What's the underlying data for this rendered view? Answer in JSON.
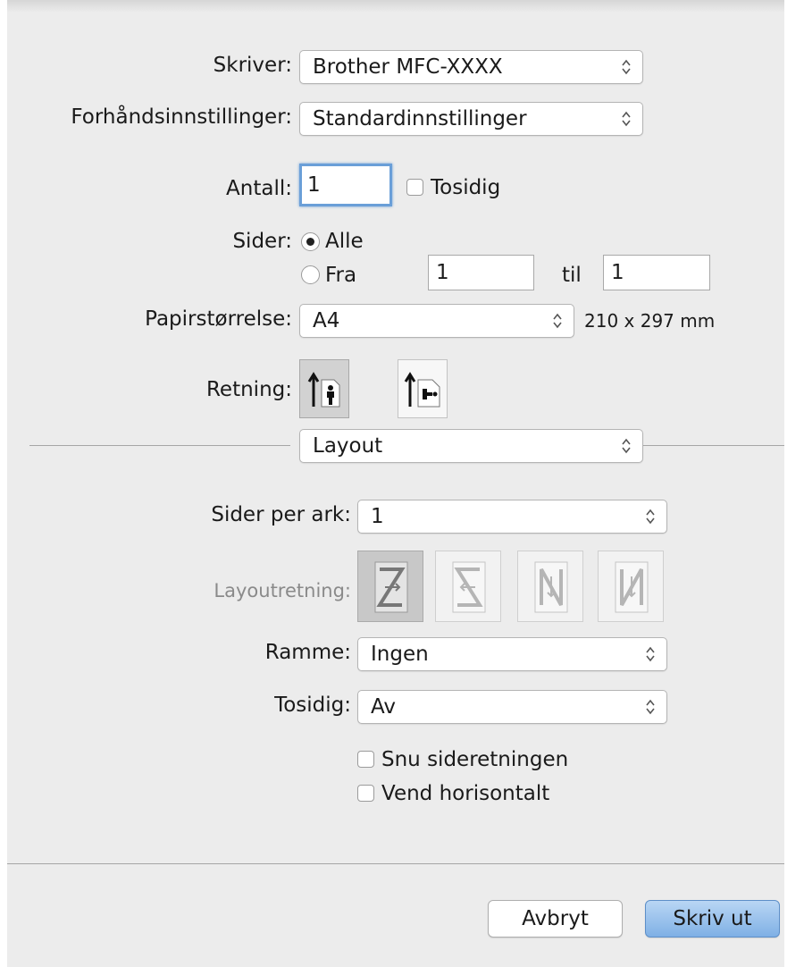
{
  "printer": {
    "label": "Skriver:",
    "value": "Brother MFC-XXXX"
  },
  "presets": {
    "label": "Forhåndsinnstillinger:",
    "value": "Standardinnstillinger"
  },
  "copies": {
    "label": "Antall:",
    "value": "1",
    "two_sided_label": "Tosidig",
    "two_sided_checked": false
  },
  "pages": {
    "label": "Sider:",
    "all_label": "Alle",
    "from_label": "Fra",
    "from_value": "1",
    "to_label": "til",
    "to_value": "1",
    "selected": "all"
  },
  "paper_size": {
    "label": "Papirstørrelse:",
    "value": "A4",
    "dimensions": "210 x 297 mm"
  },
  "orientation": {
    "label": "Retning:",
    "selected": "portrait",
    "icons": [
      "portrait-orientation-icon",
      "landscape-orientation-icon"
    ]
  },
  "section_menu": {
    "value": "Layout"
  },
  "layout": {
    "pages_per_sheet": {
      "label": "Sider per ark:",
      "value": "1"
    },
    "layout_direction": {
      "label": "Layoutretning:",
      "icons": [
        "z-order-icon",
        "reverse-s-order-icon",
        "n-reverse-order-icon",
        "n-order-icon"
      ],
      "selected_index": 0
    },
    "border": {
      "label": "Ramme:",
      "value": "Ingen"
    },
    "two_sided": {
      "label": "Tosidig:",
      "value": "Av"
    },
    "reverse_orientation": {
      "label": "Snu sideretningen",
      "checked": false
    },
    "flip_horizontal": {
      "label": "Vend horisontalt",
      "checked": false
    }
  },
  "buttons": {
    "cancel": "Avbryt",
    "print": "Skriv ut"
  },
  "colors": {
    "dialog_bg": "#ececec",
    "focus": "#6a9fd8",
    "default_button": "#7fb0e5"
  }
}
